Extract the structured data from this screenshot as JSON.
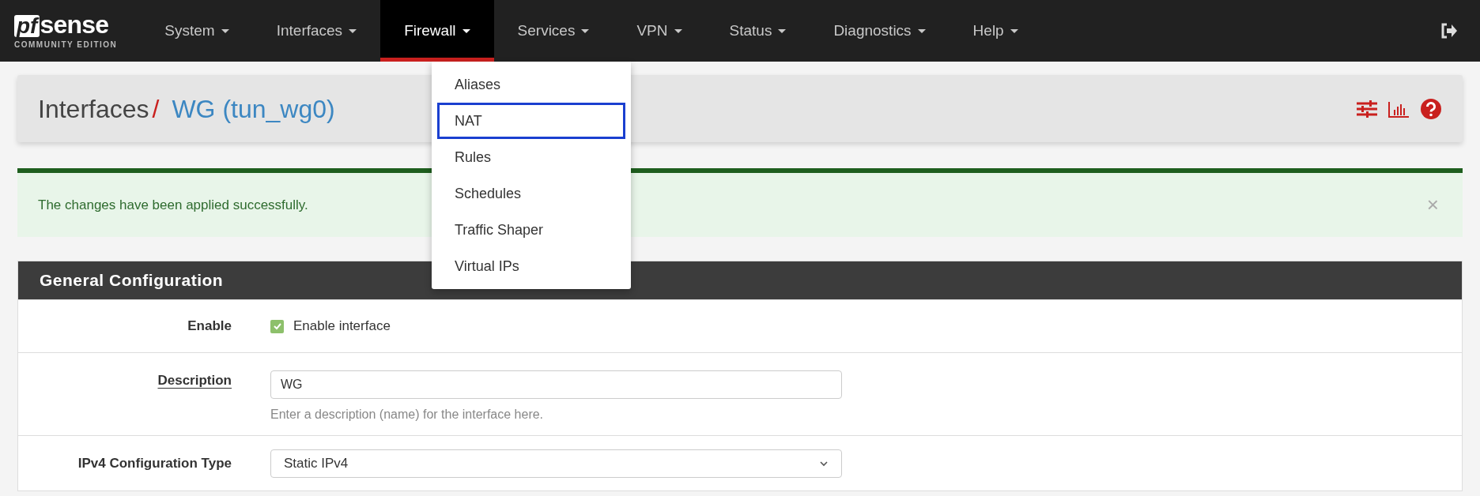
{
  "brand": {
    "name": "sense",
    "prefix": "pf",
    "edition": "COMMUNITY EDITION"
  },
  "nav": [
    {
      "label": "System",
      "selected": false
    },
    {
      "label": "Interfaces",
      "selected": false
    },
    {
      "label": "Firewall",
      "selected": true
    },
    {
      "label": "Services",
      "selected": false
    },
    {
      "label": "VPN",
      "selected": false
    },
    {
      "label": "Status",
      "selected": false
    },
    {
      "label": "Diagnostics",
      "selected": false
    },
    {
      "label": "Help",
      "selected": false
    }
  ],
  "dropdown": [
    {
      "label": "Aliases",
      "selected": false
    },
    {
      "label": "NAT",
      "selected": true
    },
    {
      "label": "Rules",
      "selected": false
    },
    {
      "label": "Schedules",
      "selected": false
    },
    {
      "label": "Traffic Shaper",
      "selected": false
    },
    {
      "label": "Virtual IPs",
      "selected": false
    }
  ],
  "breadcrumb": {
    "parent": "Interfaces",
    "separator": "/",
    "current": "WG (tun_wg0)"
  },
  "alert": {
    "message": "The changes have been applied successfully.",
    "close": "×"
  },
  "panel": {
    "title": "General Configuration",
    "rows": [
      {
        "kind": "checkbox",
        "label": "Enable",
        "text": "Enable interface",
        "checked": true
      },
      {
        "kind": "input",
        "label": "Description",
        "value": "WG",
        "help": "Enter a description (name) for the interface here."
      },
      {
        "kind": "select",
        "label": "IPv4 Configuration Type",
        "value": "Static IPv4"
      }
    ]
  }
}
